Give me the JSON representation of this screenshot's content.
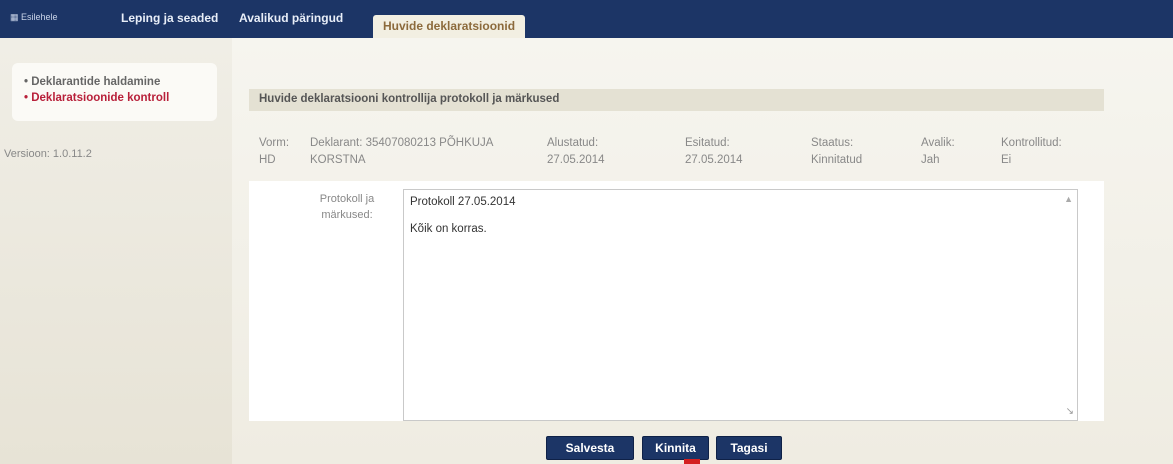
{
  "topbar": {
    "home_label": "Esilehele",
    "tabs": [
      {
        "label": "Leping ja seaded"
      },
      {
        "label": "Avalikud päringud"
      },
      {
        "label": "Huvide deklaratsioonid"
      }
    ]
  },
  "sidebar": {
    "items": [
      {
        "label": "Deklarantide haldamine"
      },
      {
        "label": "Deklaratsioonide kontroll"
      }
    ],
    "version": "Versioon: 1.0.11.2"
  },
  "panel": {
    "title": "Huvide deklaratsiooni kontrollija protokoll ja märkused",
    "info": {
      "vorm": [
        "Vorm:",
        "HD"
      ],
      "deklarant": [
        "Deklarant: 35407080213 PÕHKUJA",
        "KORSTNA"
      ],
      "alustatud": [
        "Alustatud:",
        "27.05.2014"
      ],
      "esitatud": [
        "Esitatud:",
        "27.05.2014"
      ],
      "staatus": [
        "Staatus:",
        "Kinnitatud"
      ],
      "avalik": [
        "Avalik:",
        "Jah"
      ],
      "kontrollitud": [
        "Kontrollitud:",
        "Ei"
      ]
    },
    "field_label": [
      "Protokoll ja",
      "märkused:"
    ],
    "textarea_lines": [
      "Protokoll 27.05.2014",
      "Kõik on korras."
    ]
  },
  "buttons": {
    "save": "Salvesta",
    "confirm": "Kinnita",
    "back": "Tagasi"
  },
  "colors": {
    "topbar": "#1c3566",
    "active_tab_text": "#8c6a3c",
    "menu_active": "#b8203a",
    "button": "#1c3566"
  }
}
